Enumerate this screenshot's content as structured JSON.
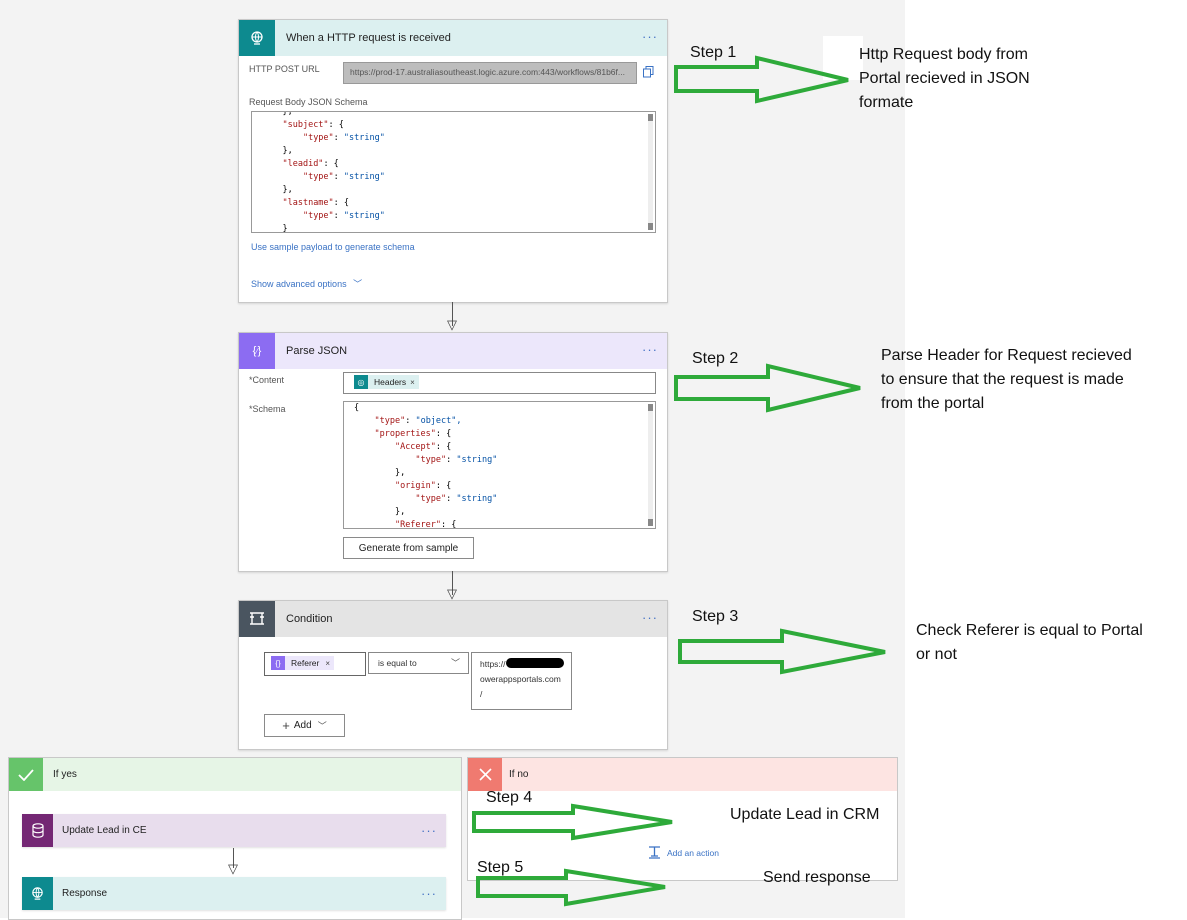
{
  "flow": {
    "http_trigger": {
      "title": "When a HTTP request is received",
      "post_url_label": "HTTP POST URL",
      "post_url_value": "https://prod-17.australiasoutheast.logic.azure.com:443/workflows/81b6f...",
      "schema_label": "Request Body JSON Schema",
      "schema_lines": [
        {
          "indent": 1,
          "text": "},"
        },
        {
          "indent": 1,
          "key": "\"subject\"",
          "rest": ": {"
        },
        {
          "indent": 2,
          "key": "\"type\"",
          "rest": ": ",
          "val": "\"string\""
        },
        {
          "indent": 1,
          "text": "},"
        },
        {
          "indent": 1,
          "key": "\"leadid\"",
          "rest": ": {"
        },
        {
          "indent": 2,
          "key": "\"type\"",
          "rest": ": ",
          "val": "\"string\""
        },
        {
          "indent": 1,
          "text": "},"
        },
        {
          "indent": 1,
          "key": "\"lastname\"",
          "rest": ": {"
        },
        {
          "indent": 2,
          "key": "\"type\"",
          "rest": ": ",
          "val": "\"string\""
        },
        {
          "indent": 1,
          "text": "}"
        }
      ],
      "sample_payload_link": "Use sample payload to generate schema",
      "advanced_options_link": "Show advanced options"
    },
    "parse_json": {
      "title": "Parse JSON",
      "content_label": "*Content",
      "content_token": "Headers",
      "schema_label": "*Schema",
      "schema_lines": [
        {
          "indent": 0,
          "text": "{"
        },
        {
          "indent": 1,
          "key": "\"type\"",
          "rest": ": ",
          "val": "\"object\","
        },
        {
          "indent": 1,
          "key": "\"properties\"",
          "rest": ": {"
        },
        {
          "indent": 2,
          "key": "\"Accept\"",
          "rest": ": {"
        },
        {
          "indent": 3,
          "key": "\"type\"",
          "rest": ": ",
          "val": "\"string\""
        },
        {
          "indent": 2,
          "text": "},"
        },
        {
          "indent": 2,
          "key": "\"origin\"",
          "rest": ": {"
        },
        {
          "indent": 3,
          "key": "\"type\"",
          "rest": ": ",
          "val": "\"string\""
        },
        {
          "indent": 2,
          "text": "},"
        },
        {
          "indent": 2,
          "key": "\"Referer\"",
          "rest": ": {"
        }
      ],
      "generate_button": "Generate from sample"
    },
    "condition": {
      "title": "Condition",
      "left_token": "Referer",
      "operator": "is equal to",
      "value_lines": [
        "https://",
        "owerappsportals.com",
        "/"
      ],
      "add_button": "Add"
    },
    "if_yes": {
      "title": "If yes",
      "update_action": "Update Lead in CE",
      "response_action": "Response"
    },
    "if_no": {
      "title": "If no",
      "add_action": "Add an action"
    }
  },
  "annotations": {
    "step1": {
      "label": "Step 1",
      "text": [
        "Http Request body from",
        "Portal recieved in JSON",
        "formate"
      ]
    },
    "step2": {
      "label": "Step 2",
      "text": [
        "Parse Header for Request recieved",
        "to ensure that the request is made",
        "from the portal"
      ]
    },
    "step3": {
      "label": "Step 3",
      "text": [
        "Check Referer is equal to Portal",
        "or not"
      ]
    },
    "step4": {
      "label": "Step 4",
      "text": [
        "Update Lead in CRM"
      ]
    },
    "step5": {
      "label": "Step 5",
      "text": [
        "Send response"
      ]
    }
  },
  "colors": {
    "http_accent": "#0d8a8f",
    "http_header_bg": "#dcf0f0",
    "parse_accent": "#8c6cf2",
    "parse_header_bg": "#ece7fb",
    "condition_accent": "#4a5560",
    "condition_header_bg": "#e4e4e4",
    "yes_accent": "#66c46a",
    "yes_header_bg": "#e6f5e6",
    "no_accent": "#f07a70",
    "no_header_bg": "#fde4e2",
    "dataverse_accent": "#742774",
    "dataverse_bg": "#e8dded",
    "annotation_arrow": "#2eaa3a"
  }
}
